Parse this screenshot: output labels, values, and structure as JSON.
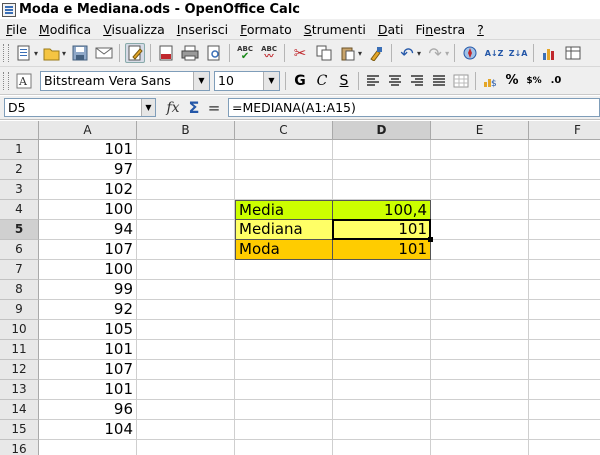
{
  "window": {
    "title": "Moda e Mediana.ods - OpenOffice Calc"
  },
  "menu": [
    {
      "first": "F",
      "rest": "ile"
    },
    {
      "first": "M",
      "rest": "odifica"
    },
    {
      "first": "V",
      "rest": "isualizza"
    },
    {
      "first": "I",
      "rest": "nserisci"
    },
    {
      "first": "F",
      "rest": "ormato"
    },
    {
      "first": "S",
      "rest": "trumenti"
    },
    {
      "first": "D",
      "rest": "ati"
    },
    {
      "first": "",
      "rest": "Fi",
      "u": "n",
      "tail": "estra"
    },
    {
      "first": "?",
      "rest": ""
    }
  ],
  "toolbar": {
    "spell_label": "ABC",
    "sort_az": "A↓Z",
    "sort_za": "Z↓A"
  },
  "format": {
    "font_name": "Bitstream Vera Sans",
    "font_size": "10",
    "bold": "G",
    "italic": "C",
    "underline": "S",
    "percent": "%",
    "currency": "$%",
    "decimal": ".0"
  },
  "formula_bar": {
    "cell_ref": "D5",
    "fx": "fx",
    "sum": "Σ",
    "equals": "=",
    "formula": "=MEDIANA(A1:A15)"
  },
  "sheet": {
    "columns": [
      "A",
      "B",
      "C",
      "D",
      "E",
      "F"
    ],
    "rows": [
      "1",
      "2",
      "3",
      "4",
      "5",
      "6",
      "7",
      "8",
      "9",
      "10",
      "11",
      "12",
      "13",
      "14",
      "15",
      "16"
    ],
    "col_a": [
      "101",
      "97",
      "102",
      "100",
      "94",
      "107",
      "100",
      "99",
      "92",
      "105",
      "101",
      "107",
      "101",
      "96",
      "104"
    ],
    "summary": [
      {
        "label": "Media",
        "value": "100,4",
        "color": "#ccff00"
      },
      {
        "label": "Mediana",
        "value": "101",
        "color": "#ffff66"
      },
      {
        "label": "Moda",
        "value": "101",
        "color": "#ffcc00"
      }
    ],
    "selected_cell": "D5"
  },
  "colors": {
    "grid_line": "#cfcfcf",
    "header_bg": "#e8e8e8",
    "header_selected_bg": "#d0d0d0"
  }
}
